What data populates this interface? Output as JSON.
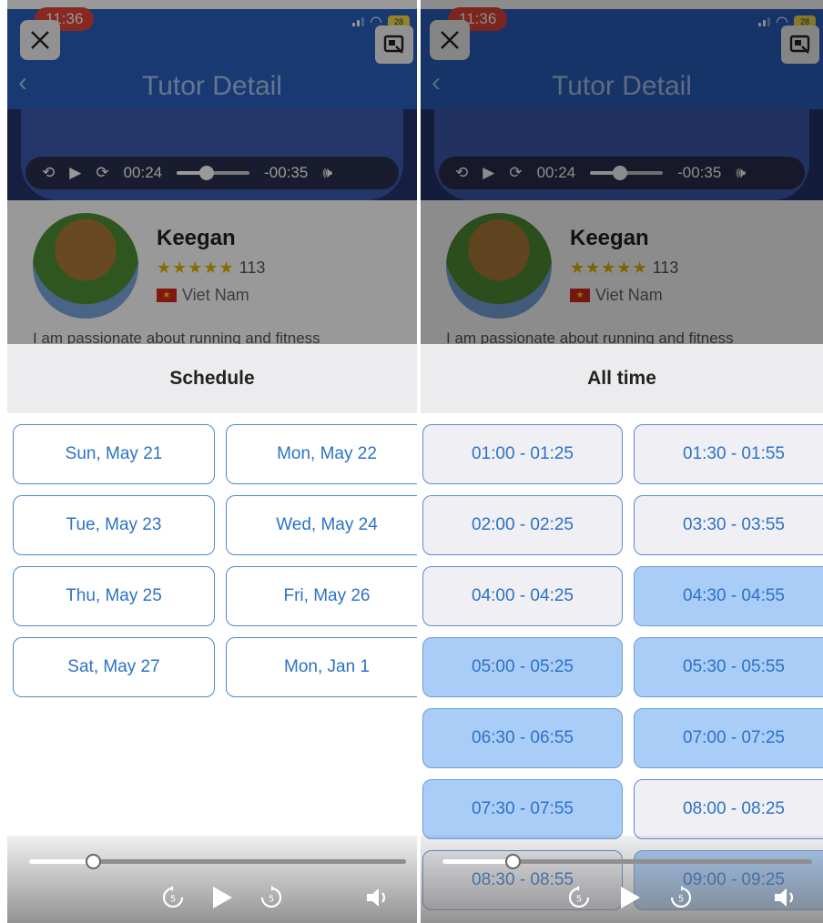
{
  "status_bar": {
    "time": "11:36",
    "battery": "28"
  },
  "header": {
    "title": "Tutor Detail"
  },
  "video": {
    "elapsed": "00:24",
    "remaining": "-00:35",
    "progress": 0.41
  },
  "tutor": {
    "name": "Keegan",
    "stars": "★★★★★",
    "reviews": "113",
    "country": "Viet Nam",
    "flag_symbol": "★",
    "bio": "I am passionate about running and fitness"
  },
  "left_sheet": {
    "title": "Schedule",
    "dates": [
      "Sun, May 21",
      "Mon, May 22",
      "Tue, May 23",
      "Wed, May 24",
      "Thu, May 25",
      "Fri, May 26",
      "Sat, May 27",
      "Mon, Jan 1"
    ]
  },
  "right_sheet": {
    "title": "All time",
    "slots": [
      {
        "label": "01:00 - 01:25",
        "state": "available"
      },
      {
        "label": "01:30 - 01:55",
        "state": "available"
      },
      {
        "label": "02:00 - 02:25",
        "state": "available"
      },
      {
        "label": "03:30 - 03:55",
        "state": "available"
      },
      {
        "label": "04:00 - 04:25",
        "state": "available"
      },
      {
        "label": "04:30 - 04:55",
        "state": "booked"
      },
      {
        "label": "05:00 - 05:25",
        "state": "booked"
      },
      {
        "label": "05:30 - 05:55",
        "state": "booked"
      },
      {
        "label": "06:30 - 06:55",
        "state": "booked"
      },
      {
        "label": "07:00 - 07:25",
        "state": "booked"
      },
      {
        "label": "07:30 - 07:55",
        "state": "booked"
      },
      {
        "label": "08:00 - 08:25",
        "state": "available"
      },
      {
        "label": "08:30 - 08:55",
        "state": "available"
      },
      {
        "label": "09:00 - 09:25",
        "state": "booked"
      }
    ]
  },
  "media": {
    "left_progress": 0.17,
    "right_progress": 0.19,
    "rewind_seconds": "5",
    "forward_seconds": "5"
  },
  "colors": {
    "accent": "#2c72c6",
    "header": "#2b5fbe",
    "booked": "#a9cdf7",
    "available": "#efeff4"
  }
}
